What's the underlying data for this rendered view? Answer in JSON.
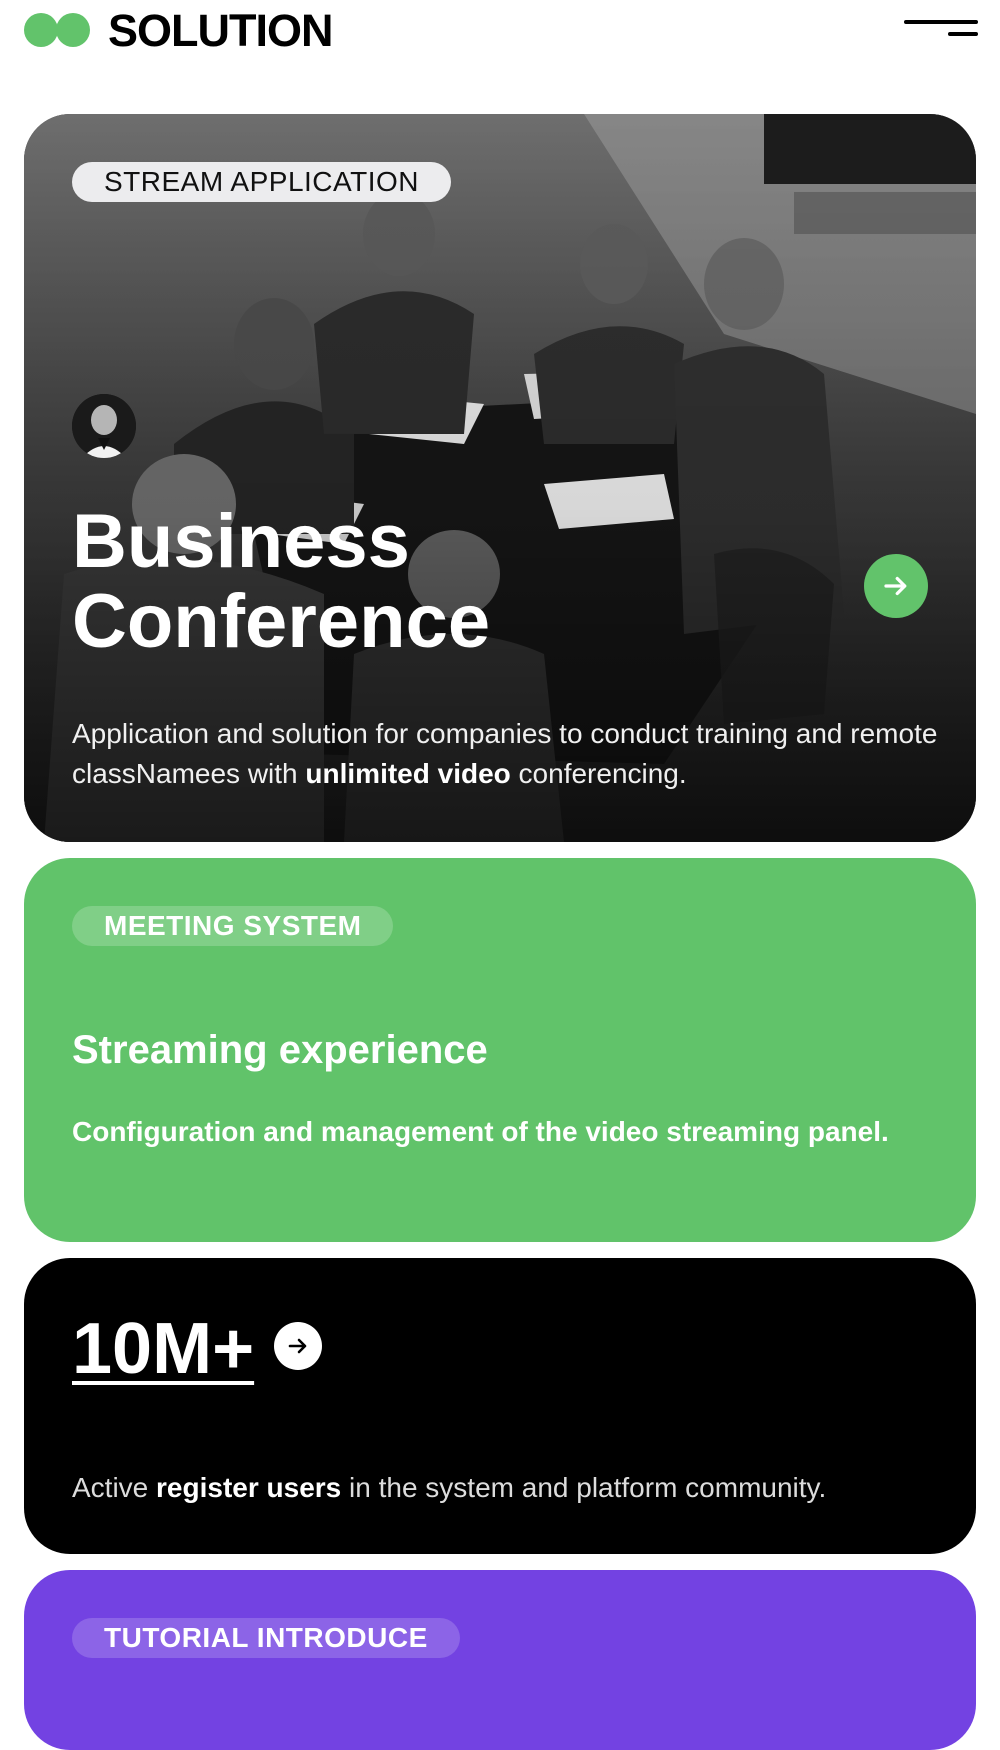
{
  "header": {
    "brand": "SOLUTION",
    "logo_color": "#62c36b",
    "menu_icon": "hamburger-menu-icon"
  },
  "cards": {
    "hero": {
      "tag": "STREAM APPLICATION",
      "title_line1": "Business",
      "title_line2": "Conference",
      "desc_pre": "Application and solution for companies to conduct training and remote classNamees with ",
      "desc_bold": "unlimited video",
      "desc_post": " conferencing.",
      "arrow_icon": "arrow-right-icon",
      "accent": "#62c36b"
    },
    "meeting": {
      "tag": "MEETING SYSTEM",
      "title": "Streaming experience",
      "desc": "Configuration and management of the video streaming panel.",
      "background": "#61c36a"
    },
    "stats": {
      "value": "10M+",
      "desc_pre": "Active ",
      "desc_bold": "register users",
      "desc_post": " in the system and platform community.",
      "arrow_icon": "arrow-right-icon",
      "background": "#000000"
    },
    "tutorial": {
      "tag": "TUTORIAL INTRODUCE",
      "background": "#7342e2"
    }
  }
}
